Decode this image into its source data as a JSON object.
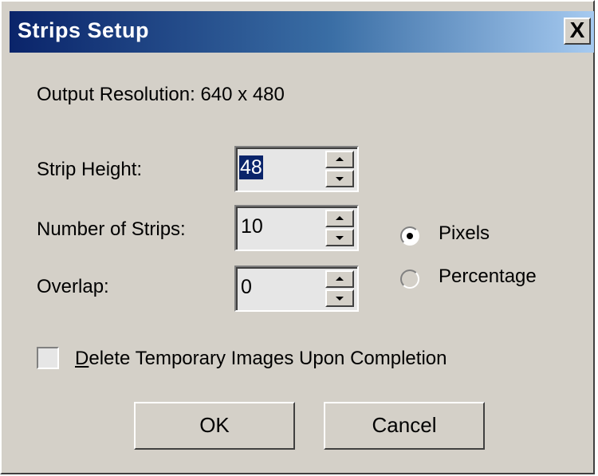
{
  "window": {
    "title": "Strips Setup",
    "close_label": "X"
  },
  "output_resolution_text": "Output Resolution: 640 x 480",
  "fields": {
    "strip_height": {
      "label": "Strip Height:",
      "value": "48"
    },
    "number_of_strips": {
      "label": "Number of Strips:",
      "value": "10"
    },
    "overlap": {
      "label": "Overlap:",
      "value": "0"
    }
  },
  "units": {
    "pixels_label": "Pixels",
    "percentage_label": "Percentage",
    "selected": "Pixels"
  },
  "delete_temp_images": {
    "first_letter": "D",
    "rest": "elete Temporary Images Upon Completion",
    "checked": false
  },
  "buttons": {
    "ok_label": "OK",
    "cancel_label": "Cancel"
  },
  "colors": {
    "title_bar_start": "#0a246a",
    "title_bar_end": "#a6caf0",
    "dialog_face": "#d4d0c8"
  }
}
